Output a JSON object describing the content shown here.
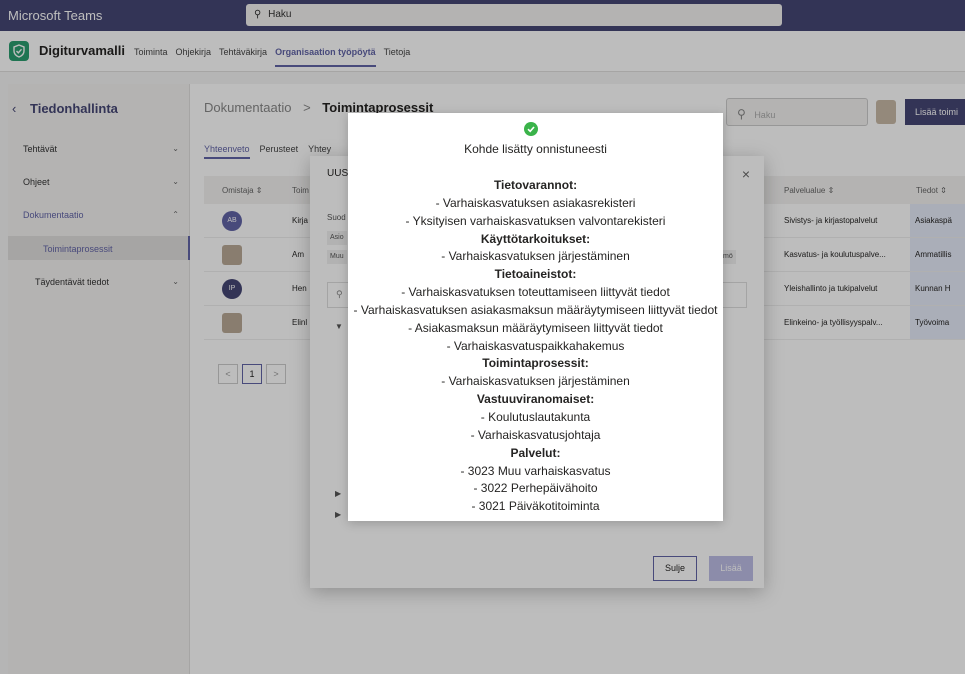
{
  "titlebar": {
    "app_name": "Microsoft Teams",
    "search_placeholder": "Haku"
  },
  "app": {
    "name": "Digiturvamalli",
    "tabs": [
      "Toiminta",
      "Ohjekirja",
      "Tehtäväkirja",
      "Organisaation työpöytä",
      "Tietoja"
    ],
    "active_tab_index": 3
  },
  "sidebar": {
    "title": "Tiedonhallinta",
    "items": [
      {
        "label": "Tehtävät"
      },
      {
        "label": "Ohjeet"
      },
      {
        "label": "Dokumentaatio"
      }
    ],
    "subitems": [
      {
        "label": "Toimintaprosessit"
      },
      {
        "label": "Täydentävät tiedot"
      }
    ]
  },
  "main": {
    "breadcrumb_parent": "Dokumentaatio",
    "breadcrumb_separator": ">",
    "breadcrumb_current": "Toimintaprosessit",
    "search_placeholder": "Haku",
    "add_button": "Lisää toimi",
    "subtabs": [
      "Yhteenveto",
      "Perusteet",
      "Yhtey"
    ],
    "columns": [
      "Omistaja ⇕",
      "Toim",
      "Palvelualue ⇕",
      "Tiedot ⇕"
    ],
    "rows": [
      {
        "avatar": "AB",
        "avatar_color": "#6264a7",
        "name": "Kirja",
        "area": "Sivistys- ja kirjastopalvelut",
        "info": "Asiakaspä"
      },
      {
        "avatar": "",
        "avatar_color": "",
        "name": "Am",
        "area": "Kasvatus- ja koulutuspalve...",
        "info": "Ammatillis"
      },
      {
        "avatar": "IP",
        "avatar_color": "#464775",
        "name": "Hen",
        "area": "Yleishallinto ja tukipalvelut",
        "info": "Kunnan H"
      },
      {
        "avatar": "",
        "avatar_color": "",
        "name": "Elinl",
        "area": "Elinkeino- ja työllisyyspalv...",
        "info": "Työvoima"
      }
    ],
    "pager": {
      "prev": "<",
      "current": "1",
      "next": ">"
    }
  },
  "dialog": {
    "title": "UUS",
    "close": "×",
    "label": "Suod",
    "chips": [
      "Asio",
      "Muu",
      "mö"
    ],
    "search_icon": "⚲",
    "cancel_label": "Sulje",
    "add_label": "Lisää"
  },
  "toast": {
    "status_icon": "check-circle-icon",
    "message": "Kohde lisätty onnistuneesti",
    "lines": [
      {
        "text": "Tietovarannot:",
        "head": true
      },
      {
        "text": "- Varhaiskasvatuksen asiakasrekisteri",
        "head": false
      },
      {
        "text": "- Yksityisen varhaiskasvatuksen valvontarekisteri",
        "head": false
      },
      {
        "text": "Käyttötarkoitukset:",
        "head": true
      },
      {
        "text": "- Varhaiskasvatuksen järjestäminen",
        "head": false
      },
      {
        "text": "Tietoaineistot:",
        "head": true
      },
      {
        "text": "- Varhaiskasvatuksen toteuttamiseen liittyvät tiedot",
        "head": false
      },
      {
        "text": "- Varhaiskasvatuksen asiakasmaksun määräytymiseen liittyvät tiedot",
        "head": false
      },
      {
        "text": "- Asiakasmaksun määräytymiseen liittyvät tiedot",
        "head": false
      },
      {
        "text": "- Varhaiskasvatuspaikkahakemus",
        "head": false
      },
      {
        "text": "Toimintaprosessit:",
        "head": true
      },
      {
        "text": "- Varhaiskasvatuksen järjestäminen",
        "head": false
      },
      {
        "text": "Vastuuviranomaiset:",
        "head": true
      },
      {
        "text": "- Koulutuslautakunta",
        "head": false
      },
      {
        "text": "- Varhaiskasvatusjohtaja",
        "head": false
      },
      {
        "text": "Palvelut:",
        "head": true
      },
      {
        "text": "- 3023 Muu varhaiskasvatus",
        "head": false
      },
      {
        "text": "- 3022 Perhepäivähoito",
        "head": false
      },
      {
        "text": "- 3021 Päiväkotitoiminta",
        "head": false
      }
    ]
  },
  "colors": {
    "brand": "#464775",
    "accent": "#6264a7",
    "success": "#3ab34a",
    "logo": "#2a9d6f"
  }
}
